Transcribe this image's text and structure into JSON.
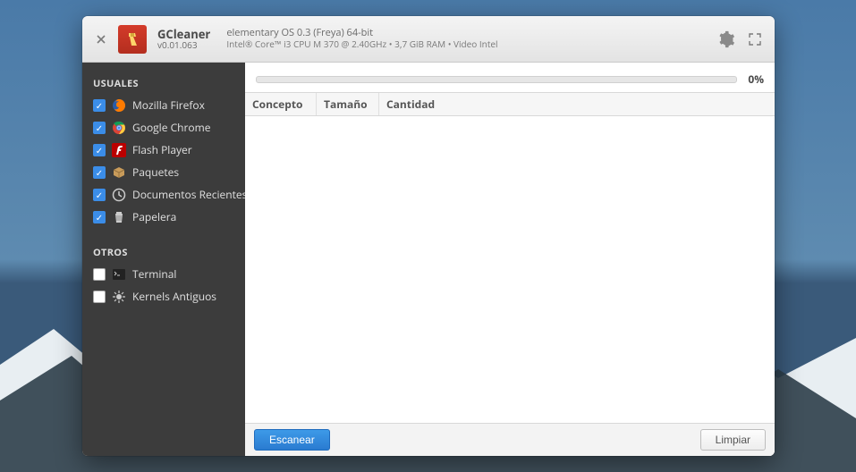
{
  "header": {
    "app_name": "GCleaner",
    "version": "v0.01.063",
    "os": "elementary OS 0.3 (Freya) 64-bit",
    "hw": "Intel® Core™ i3 CPU        M 370  @ 2.40GHz  •  3,7 GiB RAM  •  Video Intel"
  },
  "sidebar": {
    "section1_title": "USUALES",
    "section2_title": "OTROS",
    "usuales": [
      {
        "label": "Mozilla Firefox",
        "checked": true,
        "icon": "firefox-icon"
      },
      {
        "label": "Google Chrome",
        "checked": true,
        "icon": "chrome-icon"
      },
      {
        "label": "Flash Player",
        "checked": true,
        "icon": "flash-icon"
      },
      {
        "label": "Paquetes",
        "checked": true,
        "icon": "package-icon"
      },
      {
        "label": "Documentos Recientes",
        "checked": true,
        "icon": "recent-icon"
      },
      {
        "label": "Papelera",
        "checked": true,
        "icon": "trash-icon"
      }
    ],
    "otros": [
      {
        "label": "Terminal",
        "checked": false,
        "icon": "terminal-icon"
      },
      {
        "label": "Kernels Antiguos",
        "checked": false,
        "icon": "kernel-icon"
      }
    ]
  },
  "progress": {
    "percent_label": "0%"
  },
  "table": {
    "columns": [
      "Concepto",
      "Tamaño",
      "Cantidad"
    ]
  },
  "footer": {
    "scan_label": "Escanear",
    "clean_label": "Limpiar"
  }
}
